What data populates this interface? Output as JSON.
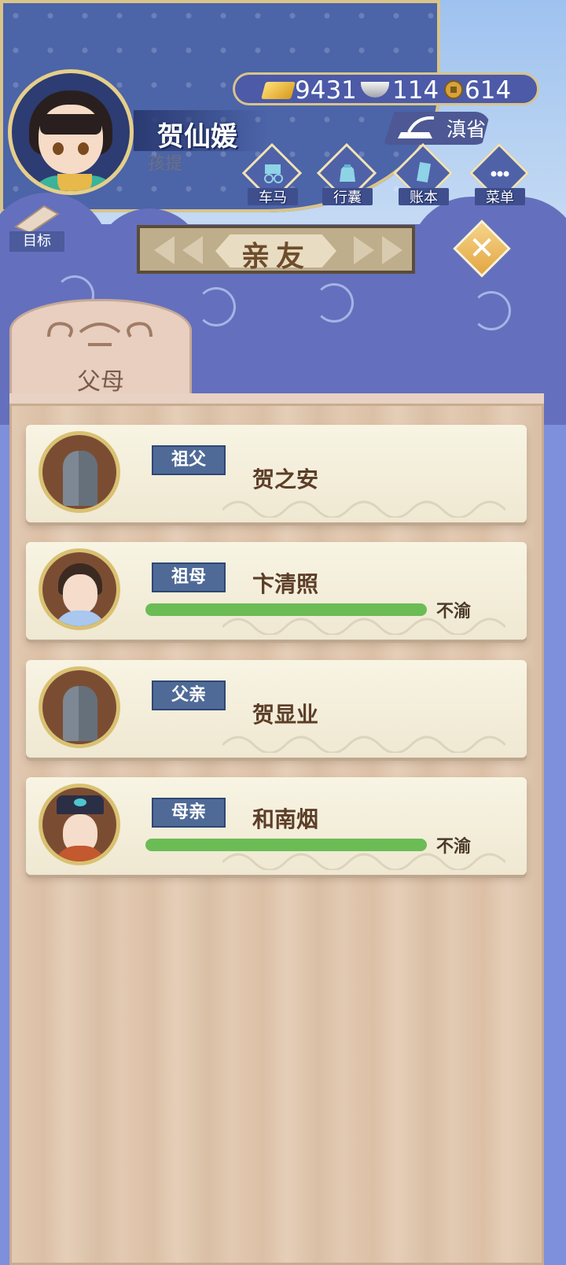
{
  "player": {
    "name": "贺仙媛",
    "age_label": "孩提"
  },
  "currency": {
    "gold": "9431",
    "silver": "114",
    "coin": "614"
  },
  "location": {
    "label": "滇省"
  },
  "menu": [
    {
      "label": "车马",
      "icon": "carriage-icon"
    },
    {
      "label": "行囊",
      "icon": "bag-icon"
    },
    {
      "label": "账本",
      "icon": "ledger-icon"
    },
    {
      "label": "菜单",
      "icon": "more-icon"
    }
  ],
  "target": {
    "label": "目标"
  },
  "page": {
    "title": "亲友"
  },
  "tab": {
    "label": "父母"
  },
  "relatives": [
    {
      "role": "祖父",
      "name": "贺之安",
      "mood": "",
      "alive": false
    },
    {
      "role": "祖母",
      "name": "卞清照",
      "mood": "不渝",
      "alive": true,
      "mood_level": 1.0
    },
    {
      "role": "父亲",
      "name": "贺显业",
      "mood": "",
      "alive": false
    },
    {
      "role": "母亲",
      "name": "和南烟",
      "mood": "不渝",
      "alive": true,
      "mood_level": 1.0
    }
  ],
  "colors": {
    "mood_bar": "#6cbc55",
    "role_tag": "#4f6a96",
    "accent_gold": "#d9c172"
  }
}
